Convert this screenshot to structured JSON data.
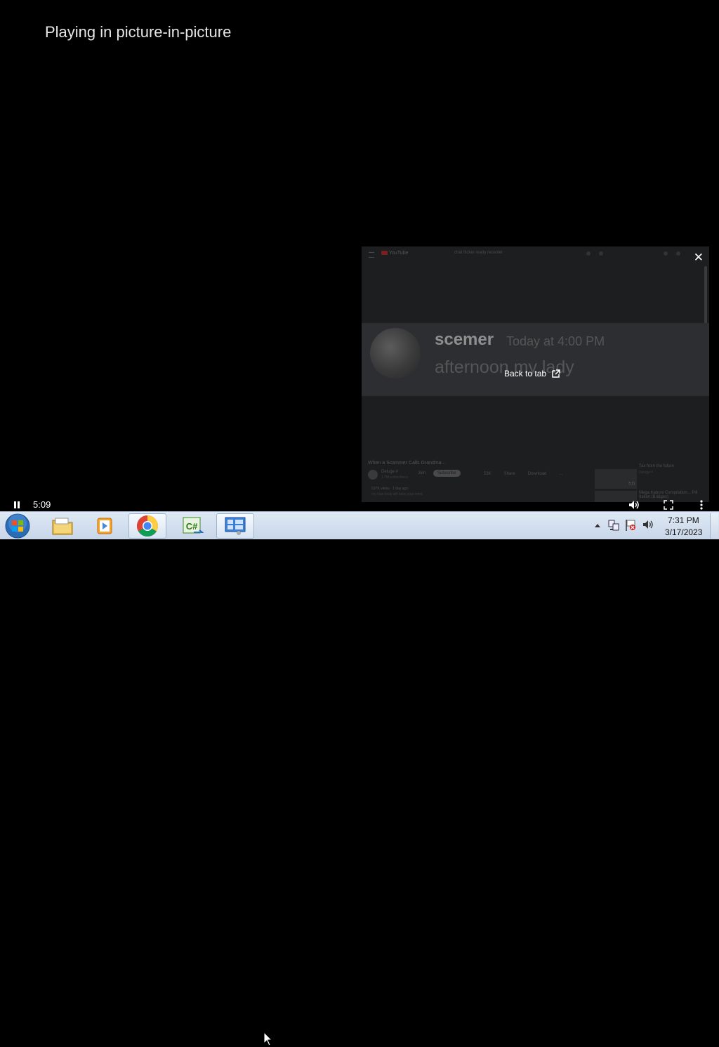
{
  "pip_page": {
    "title": "Playing in picture-in-picture",
    "time": "5:09"
  },
  "pip_window": {
    "back_to_tab": "Back to tab",
    "close": "✕",
    "youtube": {
      "logo": "YouTube",
      "search_placeholder": "chat flicker ready recenter",
      "video_title": "When a Scammer Calls Grandma...",
      "channel_name": "Deluge #",
      "channel_subs": "1.7M subscribers",
      "join": "Join",
      "subscribe": "Subscribe",
      "actions": [
        "53K",
        "Share",
        "Download",
        "..."
      ],
      "views": "537K views · 1 day ago",
      "description": "my new tools will blow your mind",
      "sidebar": [
        {
          "title": "Tax from the future",
          "sub": "Deluge #"
        },
        {
          "title": "Mega Kaboni Compilation... Pill Italian (Bridges)",
          "sub": "Kaboni # · 2.1M"
        }
      ],
      "thumb_time": "3:11"
    },
    "message": {
      "user": "scemer",
      "timestamp": "Today at 4:00 PM",
      "text": "afternoon my lady"
    }
  },
  "taskbar": {
    "apps": [
      {
        "name": "File Explorer",
        "icon": "folder-icon"
      },
      {
        "name": "Windows Media Player",
        "icon": "media-player-icon"
      },
      {
        "name": "Google Chrome",
        "icon": "chrome-icon"
      },
      {
        "name": "C# Editor",
        "icon": "csharp-icon"
      },
      {
        "name": "Control Panel",
        "icon": "control-panel-icon"
      }
    ],
    "clock": {
      "time": "7:31 PM",
      "date": "3/17/2023"
    }
  }
}
